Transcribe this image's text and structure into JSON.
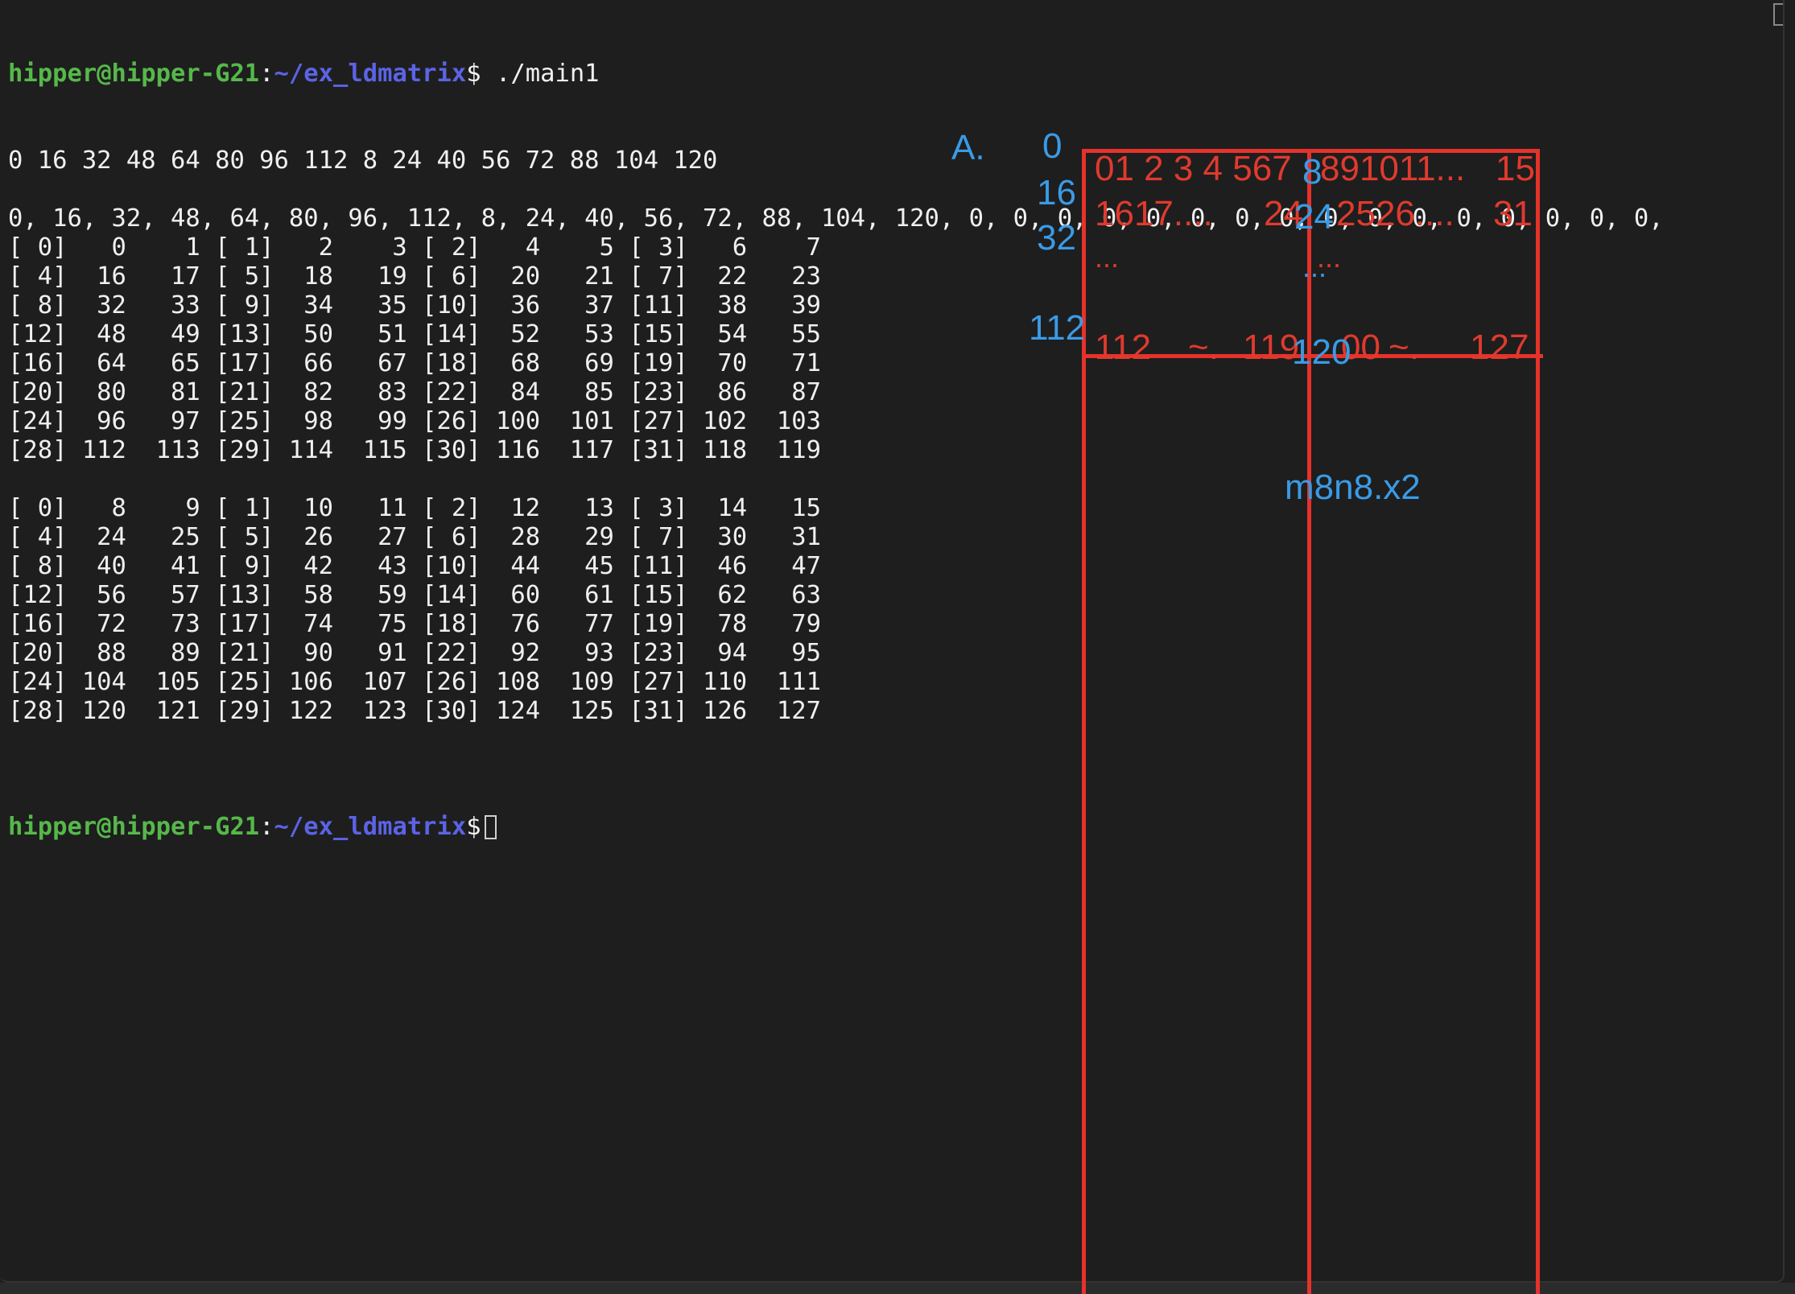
{
  "terminal": {
    "prompt_user": "hipper@hipper-G21",
    "prompt_sep": ":",
    "prompt_path": "~/ex_ldmatrix",
    "prompt_symbol": "$",
    "command": " ./main1",
    "output": [
      "0 16 32 48 64 80 96 112 8 24 40 56 72 88 104 120",
      "",
      "0, 16, 32, 48, 64, 80, 96, 112, 8, 24, 40, 56, 72, 88, 104, 120, 0, 0, 0, 0, 0, 0, 0, 0, 0, 0, 0, 0, 0, 0, 0, 0,",
      "[ 0]   0    1 [ 1]   2    3 [ 2]   4    5 [ 3]   6    7",
      "[ 4]  16   17 [ 5]  18   19 [ 6]  20   21 [ 7]  22   23",
      "[ 8]  32   33 [ 9]  34   35 [10]  36   37 [11]  38   39",
      "[12]  48   49 [13]  50   51 [14]  52   53 [15]  54   55",
      "[16]  64   65 [17]  66   67 [18]  68   69 [19]  70   71",
      "[20]  80   81 [21]  82   83 [22]  84   85 [23]  86   87",
      "[24]  96   97 [25]  98   99 [26] 100  101 [27] 102  103",
      "[28] 112  113 [29] 114  115 [30] 116  117 [31] 118  119",
      "",
      "[ 0]   8    9 [ 1]  10   11 [ 2]  12   13 [ 3]  14   15",
      "[ 4]  24   25 [ 5]  26   27 [ 6]  28   29 [ 7]  30   31",
      "[ 8]  40   41 [ 9]  42   43 [10]  44   45 [11]  46   47",
      "[12]  56   57 [13]  58   59 [14]  60   61 [15]  62   63",
      "[16]  72   73 [17]  74   75 [18]  76   77 [19]  78   79",
      "[20]  88   89 [21]  90   91 [22]  92   93 [23]  94   95",
      "[24] 104  105 [25] 106  107 [26] 108  109 [27] 110  111",
      "[28] 120  121 [29] 122  123 [30] 124  125 [31] 126  127",
      ""
    ]
  },
  "annotations": {
    "blue": {
      "label_a": "A.",
      "row_0": "0",
      "row_16": "16",
      "row_32": "32",
      "row_112": "112",
      "col_8": "8",
      "col_24": "24",
      "dots": "...",
      "col_120": "120",
      "mode": "m8n8.x2"
    },
    "red": {
      "row_a": "01 2 3 4 567",
      "row_a2": "891011...",
      "row_a_end": "15",
      "row_b": "1617....",
      "row_b2": "24",
      "row_b3": "2526....",
      "row_b_end": "31",
      "dots_left": "...",
      "dots_right": "...",
      "last_a": "112",
      "last_tilde1": "~.",
      "last_b": "119",
      "last_c": "00",
      "last_tilde2": "~.",
      "last_end": "127"
    },
    "colors": {
      "blue": "#3a9be6",
      "red": "#e03a2e",
      "prompt_user": "#56b84a",
      "prompt_path": "#5b63e6"
    }
  }
}
